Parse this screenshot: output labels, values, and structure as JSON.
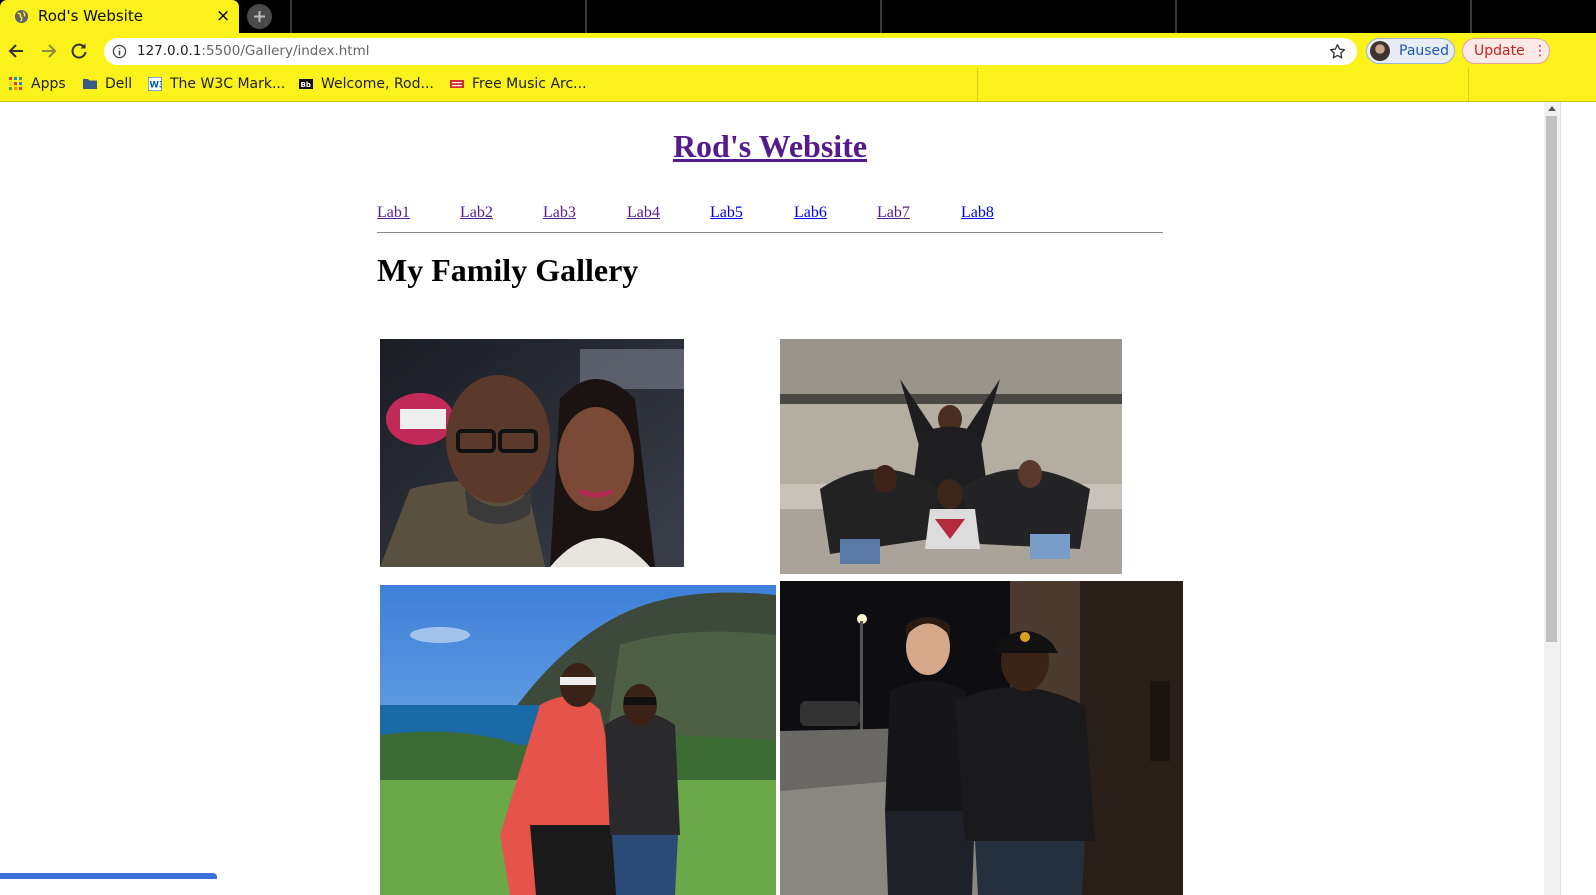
{
  "browser": {
    "tab": {
      "title": "Rod's Website",
      "close_glyph": "×"
    },
    "toolbar": {
      "url_host": "127.0.0.1",
      "url_rest": ":5500/Gallery/index.html",
      "profile_label": "Paused",
      "update_label": "Update",
      "update_menu_glyph": "⋮"
    },
    "bookmarks": [
      {
        "label": "Apps",
        "icon": "apps-grid-icon"
      },
      {
        "label": "Dell",
        "icon": "folder-icon"
      },
      {
        "label": "The W3C Mark...",
        "icon": "w3c-icon"
      },
      {
        "label": "Welcome, Rod...",
        "icon": "blackboard-icon"
      },
      {
        "label": "Free Music Arc...",
        "icon": "fma-icon"
      }
    ],
    "theme": {
      "accent": "#fbf21c",
      "tabstrip": "#000000"
    }
  },
  "page": {
    "site_title": "Rod's Website",
    "nav": [
      "Lab1",
      "Lab2",
      "Lab3",
      "Lab4",
      "Lab5",
      "Lab6",
      "Lab7",
      "Lab8"
    ],
    "visited_color": "#551a8b",
    "link_color": "#0000ee",
    "heading": "My Family Gallery",
    "photos": [
      {
        "name": "photo-couple-selfie",
        "icon": "photo-icon"
      },
      {
        "name": "photo-dance-group",
        "icon": "photo-icon"
      },
      {
        "name": "photo-coastal-mountain",
        "icon": "photo-icon"
      },
      {
        "name": "photo-night-street",
        "icon": "photo-icon"
      }
    ]
  }
}
